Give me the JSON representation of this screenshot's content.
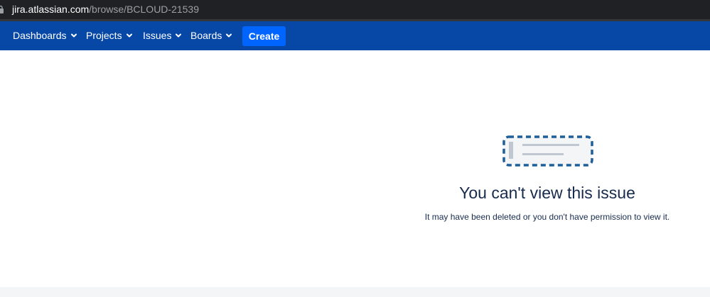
{
  "browser": {
    "url_domain": "jira.atlassian.com",
    "url_path": "/browse/BCLOUD-21539"
  },
  "nav": {
    "items": [
      {
        "label": "Dashboards",
        "icon": "chevron-down-icon"
      },
      {
        "label": "Projects",
        "icon": "chevron-down-icon"
      },
      {
        "label": "Issues",
        "icon": "chevron-down-icon"
      },
      {
        "label": "Boards",
        "icon": "chevron-down-icon"
      }
    ],
    "create_label": "Create"
  },
  "empty_state": {
    "illustration": "issue-placeholder-icon",
    "title": "You can't view this issue",
    "message": "It may have been deleted or you don't have permission to view it."
  },
  "colors": {
    "nav_background": "#0747a6",
    "create_button": "#0065ff",
    "text_primary": "#172b4d",
    "illustration_border": "#1d5f9a"
  }
}
